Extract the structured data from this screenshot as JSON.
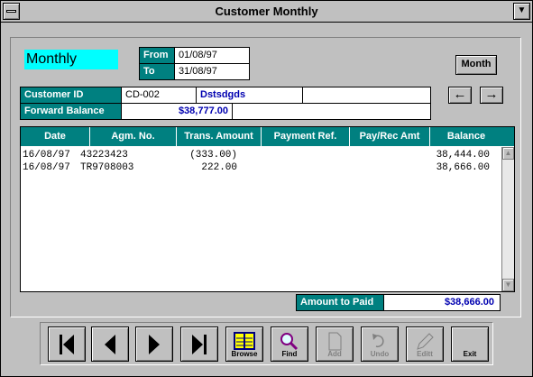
{
  "window": {
    "title": "Customer Monthly",
    "maximize_glyph": "▼"
  },
  "header": {
    "mode_label": "Monthly",
    "from_label": "From",
    "from_value": "01/08/97",
    "to_label": "To",
    "to_value": "31/08/97",
    "month_button": "Month"
  },
  "customer": {
    "id_label": "Customer ID",
    "id_value": "CD-002",
    "name_value": "Dstsdgds",
    "extra_value": "",
    "forward_label": "Forward Balance",
    "forward_value": "$38,777.00",
    "forward_extra": ""
  },
  "nav_arrows": {
    "left": "←",
    "right": "→"
  },
  "grid": {
    "columns": [
      "Date",
      "Agm. No.",
      "Trans. Amount",
      "Payment Ref.",
      "Pay/Rec Amt",
      "Balance"
    ],
    "rows": [
      {
        "date": "16/08/97",
        "agm": "43223423",
        "trans": "(333.00)",
        "payref": "",
        "payrec": "",
        "balance": "38,444.00"
      },
      {
        "date": "16/08/97",
        "agm": "TR9708003",
        "trans": "222.00",
        "payref": "",
        "payrec": "",
        "balance": "38,666.00"
      }
    ]
  },
  "footer": {
    "amount_label": "Amount to Paid",
    "amount_value": "$38,666.00"
  },
  "toolbar": {
    "browse": "Browse",
    "find": "Find",
    "add": "Add",
    "undo": "Undo",
    "edit": "Editt",
    "exit": "Exit"
  },
  "colors": {
    "teal": "#008080",
    "cyan": "#00ffff",
    "blue_text": "#0000b0",
    "face": "#c0c0c0"
  }
}
